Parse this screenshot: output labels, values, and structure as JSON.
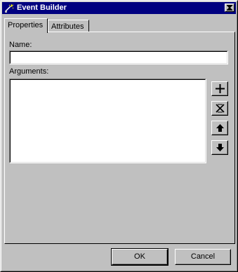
{
  "window": {
    "title": "Event Builder",
    "icon": "event-builder-icon",
    "close": "close-icon"
  },
  "tabs": [
    {
      "label": "Properties",
      "active": true
    },
    {
      "label": "Attributes",
      "active": false
    }
  ],
  "form": {
    "name_label": "Name:",
    "name_value": "",
    "arguments_label": "Arguments:",
    "arguments_items": []
  },
  "side_buttons": [
    {
      "name": "add-argument-button",
      "icon": "plus-icon"
    },
    {
      "name": "delete-argument-button",
      "icon": "delete-x-icon"
    },
    {
      "name": "move-up-button",
      "icon": "arrow-up-icon"
    },
    {
      "name": "move-down-button",
      "icon": "arrow-down-icon"
    }
  ],
  "footer": {
    "ok_label": "OK",
    "cancel_label": "Cancel"
  },
  "colors": {
    "titlebar": "#000080",
    "face": "#c0c0c0"
  }
}
